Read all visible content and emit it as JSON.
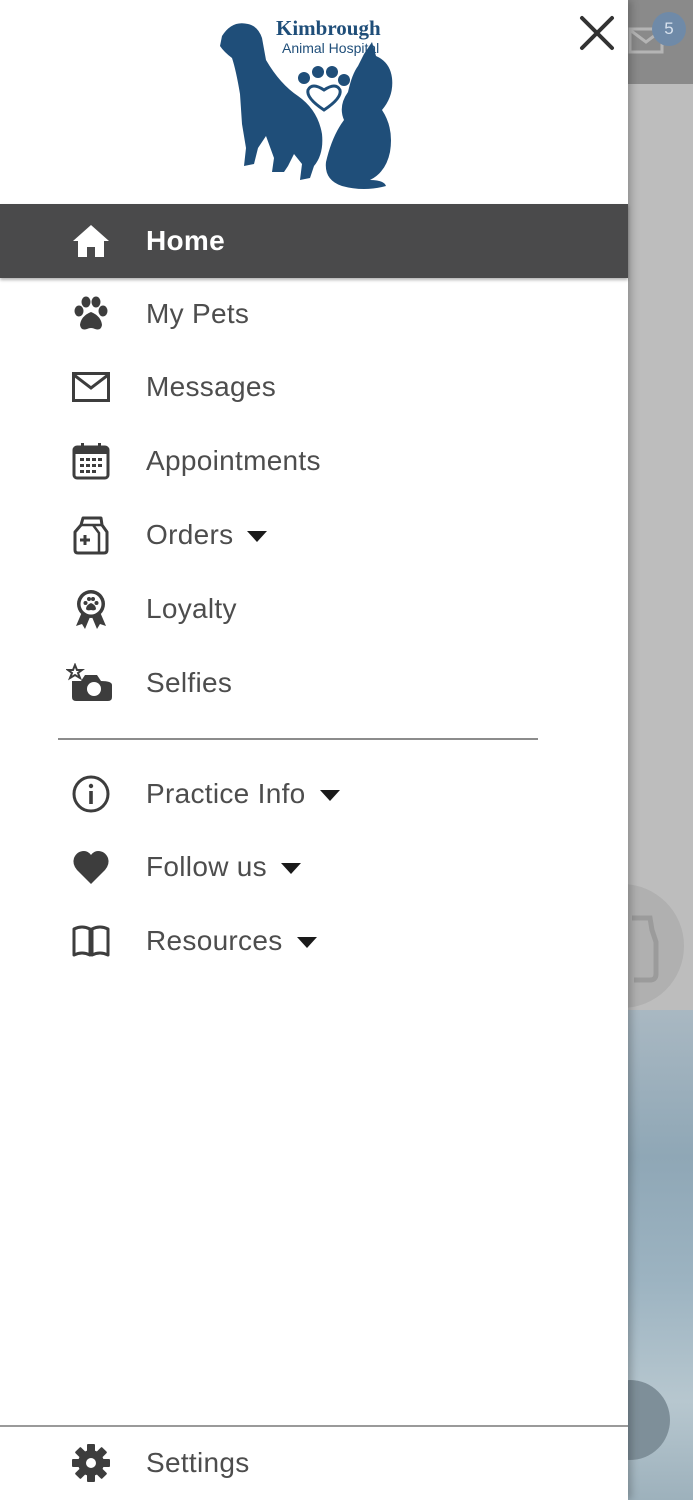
{
  "app": {
    "logo_line1": "Kimbrough",
    "logo_line2": "Animal Hospital",
    "brand_color": "#1f4e79"
  },
  "background": {
    "message_badge_count": "5"
  },
  "menu": {
    "items": [
      {
        "label": "Home",
        "icon": "home-icon",
        "active": true
      },
      {
        "label": "My Pets",
        "icon": "paw-icon"
      },
      {
        "label": "Messages",
        "icon": "mail-icon"
      },
      {
        "label": "Appointments",
        "icon": "calendar-icon"
      },
      {
        "label": "Orders",
        "icon": "pharmacy-bag-icon",
        "expandable": true
      },
      {
        "label": "Loyalty",
        "icon": "award-ribbon-icon"
      },
      {
        "label": "Selfies",
        "icon": "camera-star-icon"
      }
    ],
    "secondary_items": [
      {
        "label": "Practice Info",
        "icon": "info-icon",
        "expandable": true
      },
      {
        "label": "Follow us",
        "icon": "heart-icon",
        "expandable": true
      },
      {
        "label": "Resources",
        "icon": "book-icon",
        "expandable": true
      }
    ],
    "footer": {
      "label": "Settings",
      "icon": "gear-icon"
    }
  },
  "colors": {
    "active_bg": "#4a4a4b",
    "text": "#4d4d4d",
    "icon": "#3d3d3d"
  }
}
